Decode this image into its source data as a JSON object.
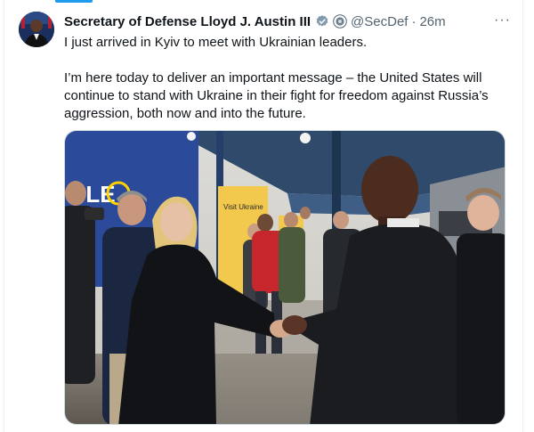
{
  "tweet": {
    "author_name": "Secretary of Defense Lloyd J. Austin III",
    "handle": "@SecDef",
    "separator": "·",
    "timestamp": "26m",
    "verified_icon": "verified-badge-icon",
    "affiliate_icon": "government-affiliate-icon",
    "more_label": "···",
    "paragraphs": [
      "I just arrived in Kyiv to meet with Ukrainian leaders.",
      "I’m here today to deliver an important message – the United States will continue to stand with Ukraine in their fight for freedom against Russia’s aggression, both now and into the future."
    ],
    "photo": {
      "sign_text": "PLE",
      "poster_text": "Visit Ukraine"
    }
  },
  "colors": {
    "accent": "#1d9bf0",
    "secondary_text": "#536471",
    "verified": "#829aab"
  }
}
